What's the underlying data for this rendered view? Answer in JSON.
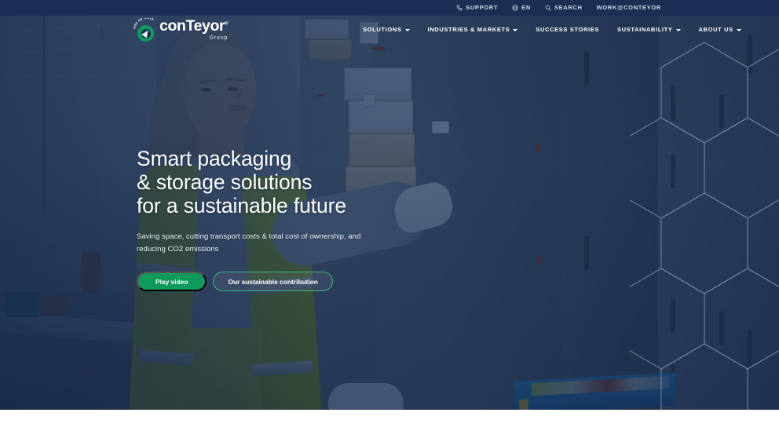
{
  "topbar": {
    "items": [
      {
        "label": "SUPPORT",
        "icon": "phone-icon"
      },
      {
        "label": "EN",
        "icon": "globe-icon"
      },
      {
        "label": "SEARCH",
        "icon": "search-icon"
      },
      {
        "label": "WORK@CONTEYOR",
        "icon": "none"
      }
    ]
  },
  "logo": {
    "arc_text": "Use no more",
    "word_a": "con",
    "word_b": "Teyor",
    "registered": "®",
    "sub": "Group",
    "mark": "leaf-arrow-icon",
    "green": "#0e9a5c"
  },
  "nav": {
    "items": [
      {
        "label": "SOLUTIONS",
        "has_caret": true
      },
      {
        "label": "INDUSTRIES & MARKETS",
        "has_caret": true
      },
      {
        "label": "SUCCESS STORIES",
        "has_caret": false
      },
      {
        "label": "SUSTAINABILITY",
        "has_caret": true
      },
      {
        "label": "ABOUT US",
        "has_caret": true
      }
    ]
  },
  "hero": {
    "headline_line1": "Smart packaging",
    "headline_line2": "& storage solutions",
    "headline_line3": "for a sustainable future",
    "subcopy": "Saving space, cutting transport costs & total cost of ownership, and reducing CO2 emissions",
    "primary_button": "Play video",
    "secondary_button": "Our sustainable contribution",
    "image_description": "Warehouse worker in yellow hi-vis vest handling cardboard boxes on blue-gray storage racks",
    "overlay_color": "#1b2f55",
    "accent_color": "#0e9a5c"
  }
}
